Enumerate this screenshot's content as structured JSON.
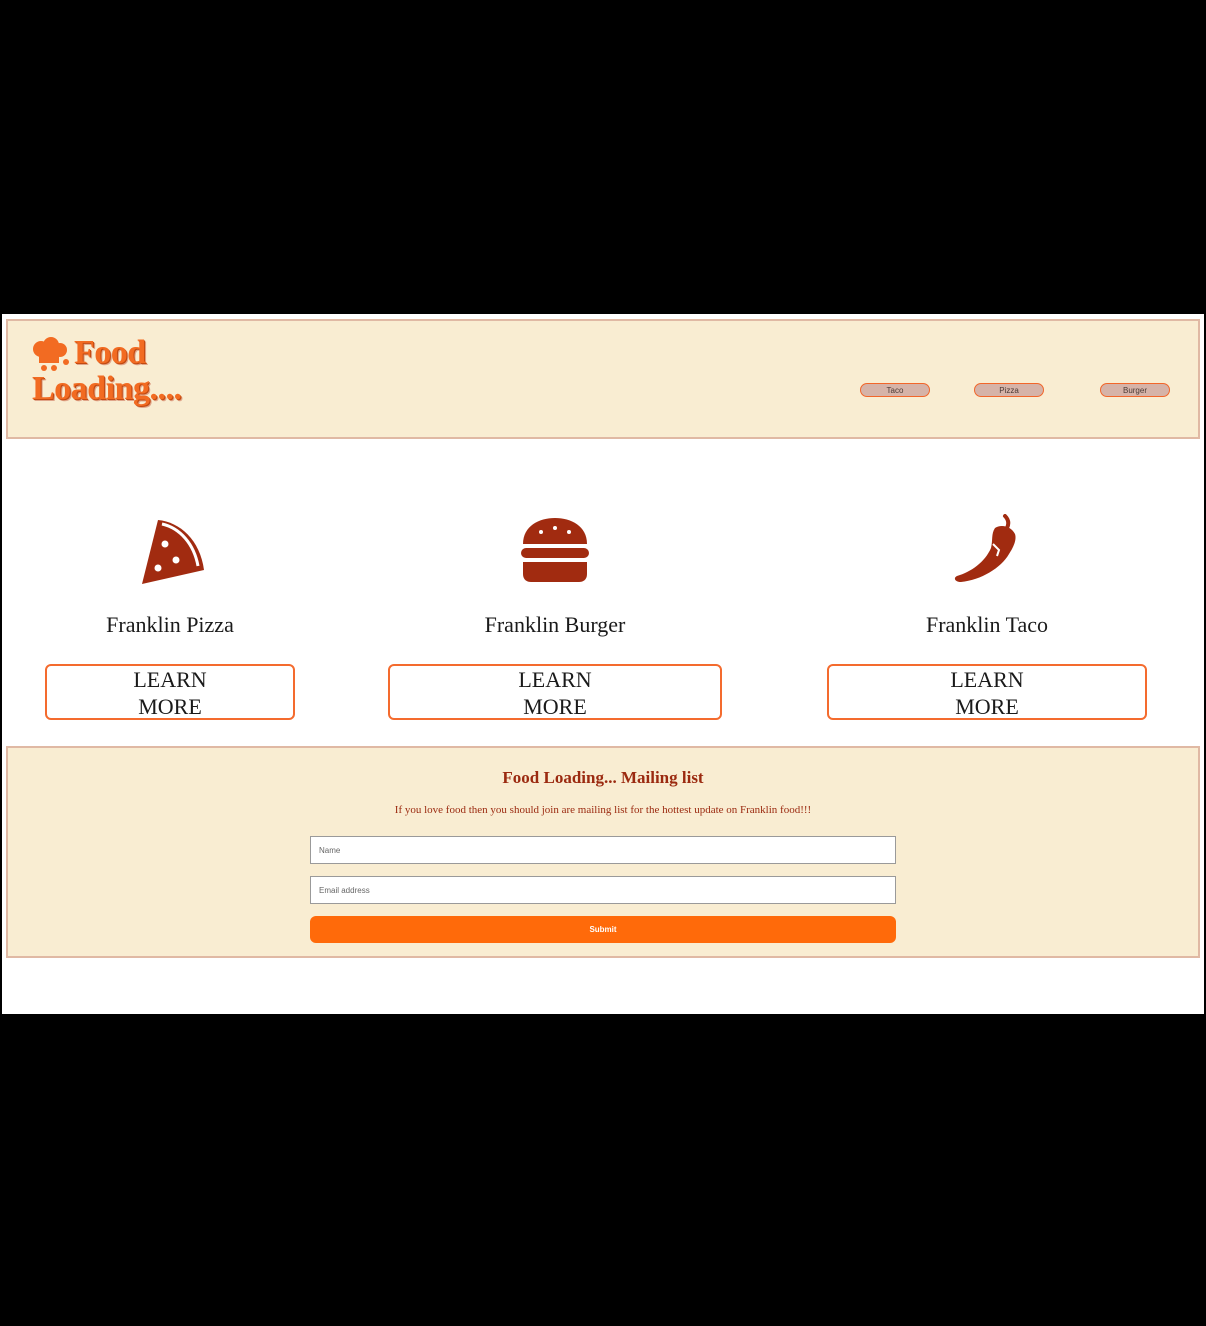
{
  "header": {
    "logo_line1": "Food",
    "logo_line2": "Loading....",
    "nav": [
      {
        "label": "Taco"
      },
      {
        "label": "Pizza"
      },
      {
        "label": "Burger"
      }
    ]
  },
  "cards": [
    {
      "title": "Franklin Pizza",
      "button_line1": "LEARN",
      "button_line2": "MORE",
      "icon": "pizza-icon"
    },
    {
      "title": "Franklin Burger",
      "button_line1": "LEARN",
      "button_line2": "MORE",
      "icon": "burger-icon"
    },
    {
      "title": "Franklin Taco",
      "button_line1": "LEARN",
      "button_line2": "MORE",
      "icon": "chili-pepper-icon"
    }
  ],
  "mailing": {
    "title": "Food Loading... Mailing list",
    "description": "If you love food then you should join are mailing list for the hottest update on Franklin food!!!",
    "name_placeholder": "Name",
    "email_placeholder": "Email address",
    "submit_label": "Submit"
  },
  "colors": {
    "accent": "#f26b22",
    "dark_red": "#9b2a10",
    "cream": "#f9edd2",
    "submit": "#ff6a0a"
  }
}
